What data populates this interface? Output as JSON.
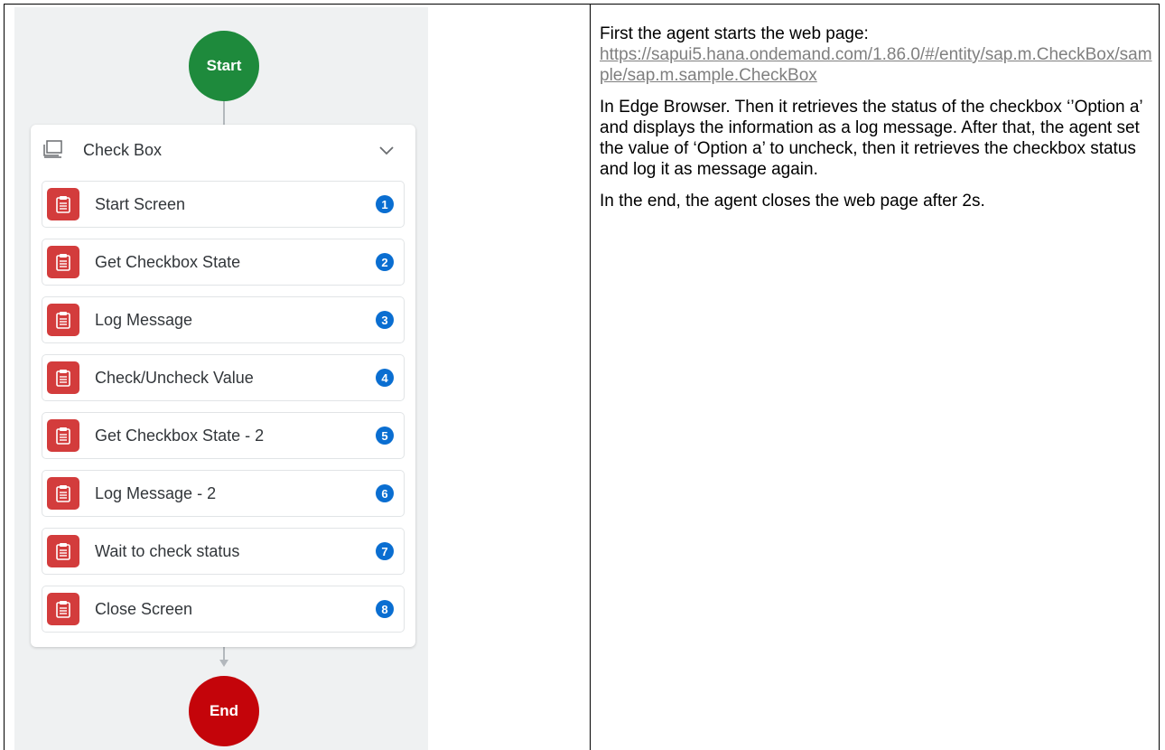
{
  "flow": {
    "start_label": "Start",
    "end_label": "End",
    "group": {
      "title": "Check Box",
      "icon": "screen-icon",
      "collapse_icon": "chevron-down-icon"
    },
    "steps": [
      {
        "label": "Start Screen",
        "badge": "1"
      },
      {
        "label": "Get Checkbox State",
        "badge": "2"
      },
      {
        "label": "Log Message",
        "badge": "3"
      },
      {
        "label": "Check/Uncheck Value",
        "badge": "4"
      },
      {
        "label": "Get Checkbox State - 2",
        "badge": "5"
      },
      {
        "label": "Log Message - 2",
        "badge": "6"
      },
      {
        "label": "Wait to check status",
        "badge": "7"
      },
      {
        "label": "Close Screen",
        "badge": "8"
      }
    ],
    "step_icon": "clipboard-icon",
    "colors": {
      "start": "#1e8a3c",
      "end": "#c4040a",
      "step_icon_bg": "#d33c3c",
      "badge": "#0a6ed1"
    }
  },
  "description": {
    "intro": "First the agent starts the web page:",
    "link": "https://sapui5.hana.ondemand.com/1.86.0/#/entity/sap.m.CheckBox/sample/sap.m.sample.CheckBox",
    "body": "In Edge Browser. Then it retrieves the status of the checkbox ‘’Option a’ and displays the information as a log message. After that, the agent set the value of ‘Option a’ to uncheck, then it retrieves the checkbox status and log it as message again.",
    "closing": "In the end, the agent closes the web page after 2s."
  }
}
